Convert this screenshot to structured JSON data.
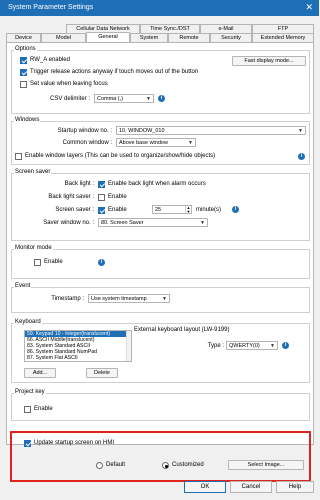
{
  "window": {
    "title": "System Parameter Settings",
    "close_glyph": "✕"
  },
  "tabs": {
    "row1": [
      "Cellular Data Network",
      "Time Sync./DST",
      "e-Mail",
      "FTP"
    ],
    "row2": [
      "Device",
      "Model",
      "General",
      "System",
      "Remote",
      "Security",
      "Extended Memory"
    ],
    "active": "General"
  },
  "options": {
    "title": "Options",
    "rw_a_enabled": {
      "label": "RW_A enabled",
      "checked": true
    },
    "fast_display_button": "Fast display mode...",
    "trigger_release": {
      "label": "Trigger release actions anyway if touch moves out of the button",
      "checked": true
    },
    "set_value": {
      "label": "Set value when leaving focus",
      "checked": false
    },
    "csv_delimiter": {
      "label": "CSV delimiter :",
      "value": "Comma (,)"
    }
  },
  "windows": {
    "title": "Windows",
    "startup": {
      "label": "Startup window no. :",
      "value": "10. WINDOW_010"
    },
    "common": {
      "label": "Common window :",
      "value": "Above base window"
    },
    "layers": {
      "label": "Enable window layers (This can be used to organize/show/hide objects)",
      "checked": false
    }
  },
  "screen_saver": {
    "title": "Screen saver",
    "back_light": {
      "label": "Back light :",
      "option": "Enable back light when alarm occurs",
      "checked": true
    },
    "back_light_saver": {
      "label": "Back light saver :",
      "option": "Enable",
      "checked": false
    },
    "screen_saver": {
      "label": "Screen saver :",
      "option": "Enable",
      "checked": true,
      "value": "25",
      "unit": "minute(s)"
    },
    "saver_window": {
      "label": "Saver window no. :",
      "value": "80. Screen Saver"
    }
  },
  "monitor_mode": {
    "title": "Monitor mode",
    "enable": {
      "label": "Enable",
      "checked": false
    }
  },
  "event": {
    "title": "Event",
    "timestamp": {
      "label": "Timestamp :",
      "value": "Use system timestamp"
    }
  },
  "keyboard": {
    "title": "Keyboard",
    "items": [
      "59. Keypad 10 - Integer(translucent)",
      "66. ASCII Middle(translucent)",
      "83. System Standard ASCII",
      "86. System Standard NumPad",
      "87. System Flat ASCII"
    ],
    "selected_index": 0,
    "add_button": "Add...",
    "delete_button": "Delete",
    "external_layout": {
      "label": "External keyboard layout (LW-9199)",
      "type_label": "Type :",
      "type_value": "QWERTY(0)"
    }
  },
  "project_key": {
    "title": "Project key",
    "enable": {
      "label": "Enable",
      "checked": false
    }
  },
  "startup_screen": {
    "update": {
      "label": "Update startup screen on HMI",
      "checked": true
    },
    "default_label": "Default",
    "customized_label": "Customized",
    "selected": "Customized",
    "select_image_button": "Select Image..."
  },
  "footer": {
    "ok": "OK",
    "cancel": "Cancel",
    "help": "Help"
  },
  "colors": {
    "accent": "#1f6fb6",
    "highlight": "#e0231c"
  },
  "icons": {
    "info": "info-icon",
    "dropdown": "chevron-down-icon"
  }
}
